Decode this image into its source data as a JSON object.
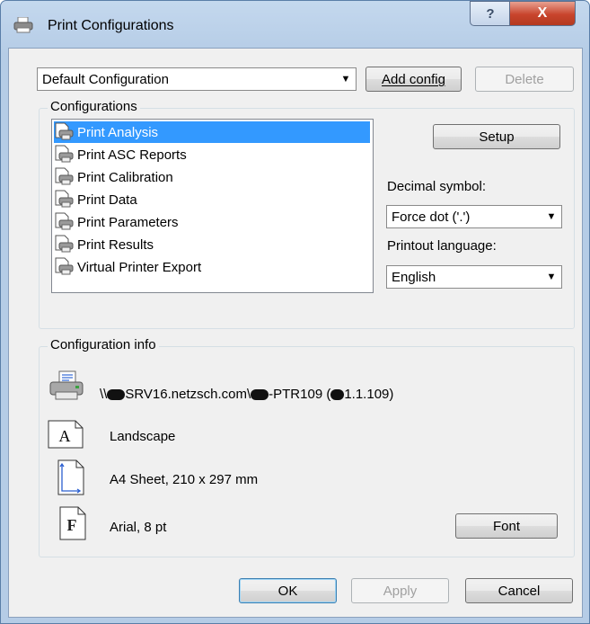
{
  "window": {
    "title": "Print Configurations",
    "help_label": "?",
    "close_label": "X"
  },
  "top": {
    "config_select": "Default Configuration",
    "add_label": "Add config",
    "delete_label": "Delete"
  },
  "configurations": {
    "legend": "Configurations",
    "items": [
      {
        "label": "Print Analysis",
        "selected": true
      },
      {
        "label": "Print ASC Reports"
      },
      {
        "label": "Print Calibration"
      },
      {
        "label": "Print Data"
      },
      {
        "label": "Print Parameters"
      },
      {
        "label": "Print Results"
      },
      {
        "label": "Virtual Printer Export"
      }
    ],
    "setup_label": "Setup",
    "decimal_label": "Decimal symbol:",
    "decimal_value": "Force dot ('.')",
    "language_label": "Printout language:",
    "language_value": "English"
  },
  "info": {
    "legend": "Configuration info",
    "printer_a": "\\\\",
    "printer_b": "SRV16.netzsch.com\\",
    "printer_c": "-PTR109 (",
    "printer_d": "1.1.109)",
    "orientation": "Landscape",
    "paper": "A4 Sheet, 210 x 297 mm",
    "font": "Arial, 8 pt",
    "font_button": "Font"
  },
  "footer": {
    "ok": "OK",
    "apply": "Apply",
    "cancel": "Cancel"
  }
}
